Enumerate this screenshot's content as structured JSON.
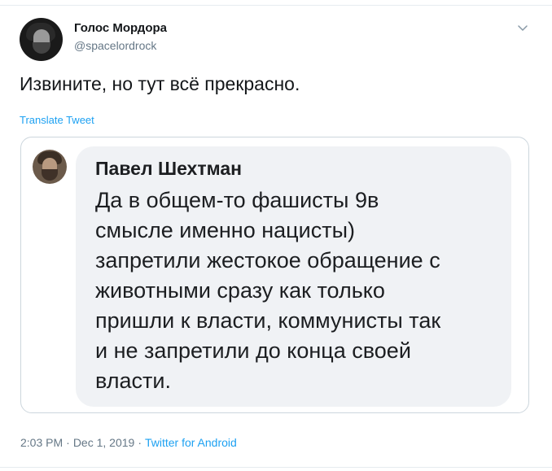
{
  "author": {
    "name": "Голос Мордора",
    "handle": "@spacelordrock"
  },
  "tweet": {
    "text": "Извините, но тут всё прекрасно.",
    "translate_label": "Translate Tweet"
  },
  "embedded_image": {
    "author_name": "Павел Шехтман",
    "text": "Да в общем-то фашисты 9в\nсмысле именно нацисты)\nзапретили жестокое обращение с\nживотными сразу как только\nпришли к власти, коммунисты так\nи не запретили до конца своей\nвласти."
  },
  "meta": {
    "time": "2:03 PM",
    "separator": "·",
    "date": "Dec 1, 2019",
    "source": "Twitter for Android"
  },
  "icons": {
    "menu": "chevron-down-icon"
  },
  "colors": {
    "link": "#1da1f2",
    "secondary_text": "#657786",
    "bubble_bg": "#f0f2f5"
  }
}
